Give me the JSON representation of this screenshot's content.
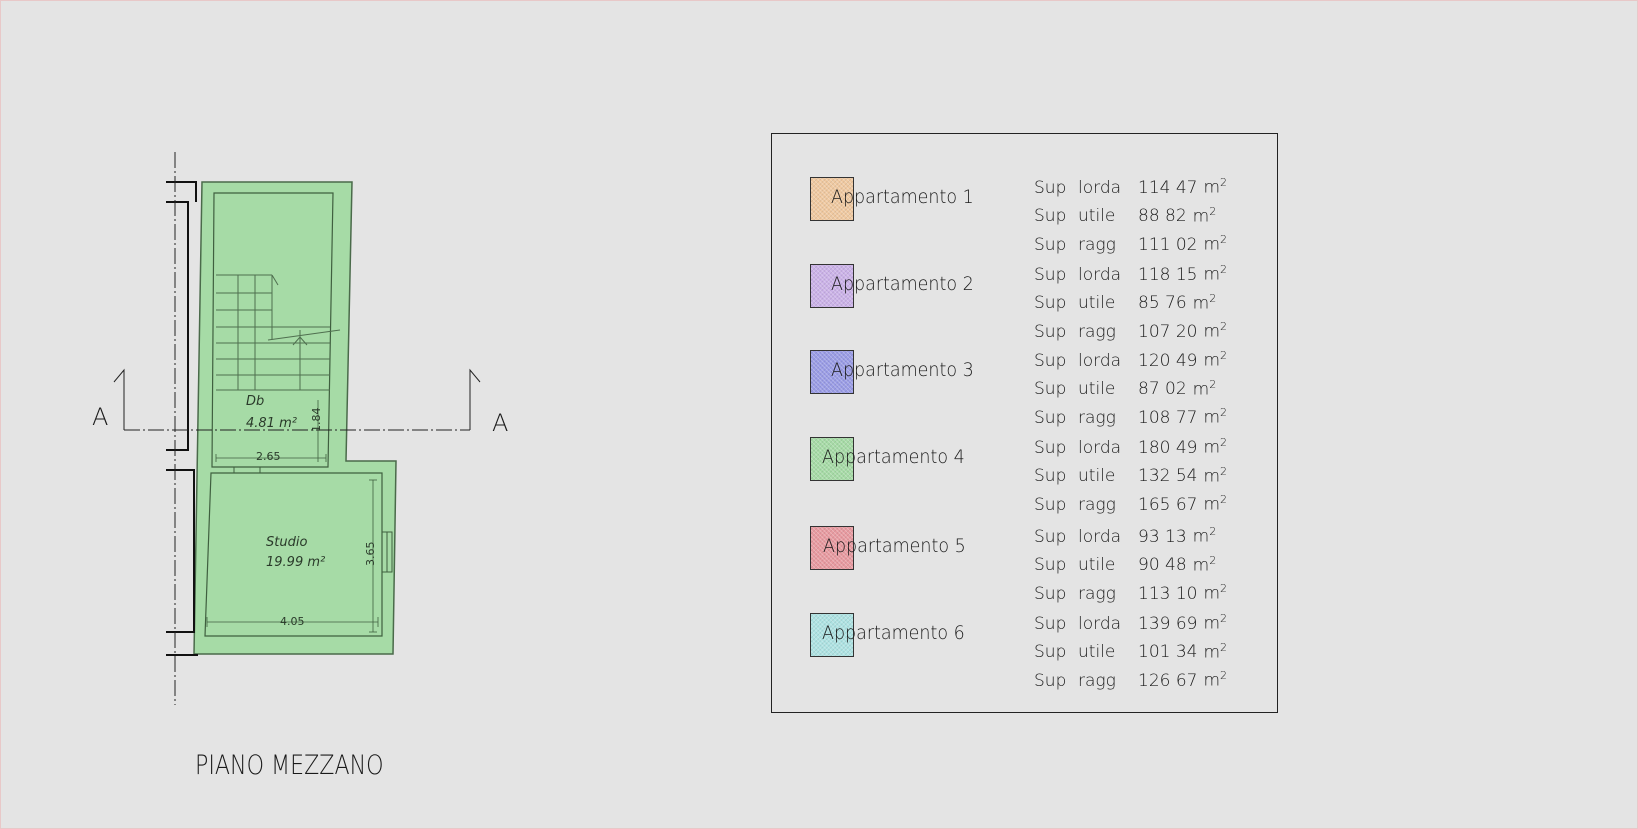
{
  "plan": {
    "title": "PIANO MEZZANO",
    "section_label_left": "A",
    "section_label_right": "A",
    "rooms": [
      {
        "name": "Db",
        "area": "4.81 m²"
      },
      {
        "name": "Studio",
        "area": "19.99 m²"
      }
    ],
    "dimensions": [
      "2.65",
      "1.84",
      "3.65",
      "4.05"
    ],
    "fill_color": "#a6dba6"
  },
  "legend": {
    "items": [
      {
        "name": "Appartamento 1",
        "color": "#f0c9a0",
        "lorda": "114 47",
        "utile": "88 82",
        "ragg": "111 02"
      },
      {
        "name": "Appartamento 2",
        "color": "#cbb2e8",
        "lorda": "118 15",
        "utile": "85 76",
        "ragg": "107 20"
      },
      {
        "name": "Appartamento 3",
        "color": "#9a9ce6",
        "lorda": "120 49",
        "utile": "87 02",
        "ragg": "108 77"
      },
      {
        "name": "Appartamento 4",
        "color": "#a6dba6",
        "lorda": "180 49",
        "utile": "132 54",
        "ragg": "165 67"
      },
      {
        "name": "Appartamento 5",
        "color": "#e89aa0",
        "lorda": "93 13",
        "utile": "90 48",
        "ragg": "113 10"
      },
      {
        "name": "Appartamento 6",
        "color": "#aee3e3",
        "lorda": "139 69",
        "utile": "101 34",
        "ragg": "126 67"
      }
    ],
    "key_label": "Sup",
    "lorda_label": "lorda",
    "utile_label": "utile",
    "ragg_label": "ragg",
    "unit": "m",
    "unit_exp": "2"
  }
}
